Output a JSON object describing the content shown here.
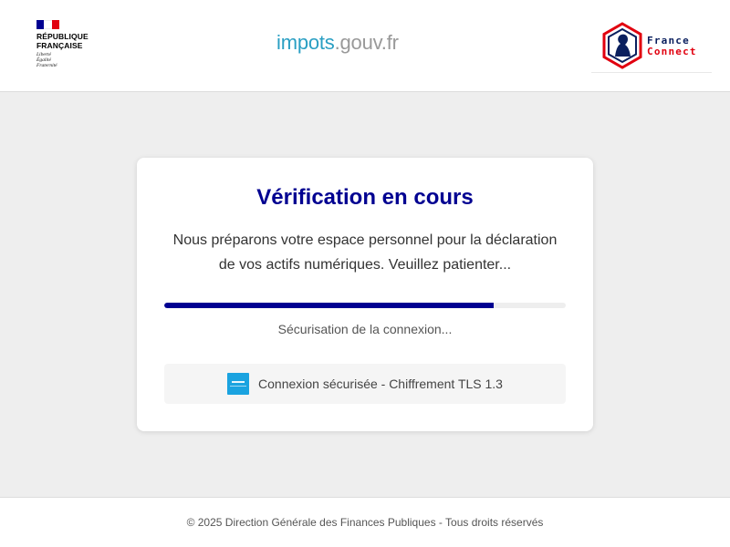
{
  "header": {
    "gov_logo": {
      "name": "RÉPUBLIQUE\nFRANÇAISE",
      "motto": "Liberté\nÉgalité\nFraternité",
      "flag_colors": [
        "#000091",
        "#ffffff",
        "#e1000f"
      ]
    },
    "site_title": {
      "part1": "impots",
      "part2": ".gouv.fr"
    },
    "franceconnect": {
      "line1": "France",
      "line2": "Connect",
      "icon": "franceconnect-hexagon-icon"
    }
  },
  "card": {
    "title": "Vérification en cours",
    "message": "Nous préparons votre espace personnel pour la déclaration de vos actifs numériques. Veuillez patienter...",
    "progress": 0.82,
    "status": "Sécurisation de la connexion...",
    "secure": {
      "icon": "secure-badge-icon",
      "text": "Connexion sécurisée - Chiffrement TLS 1.3"
    }
  },
  "footer": {
    "text": "© 2025 Direction Générale des Finances Publiques - Tous droits réservés"
  },
  "colors": {
    "primary": "#000091",
    "accent_blue": "#2a9fc3",
    "red": "#e1000f",
    "background": "#eeeeee"
  }
}
